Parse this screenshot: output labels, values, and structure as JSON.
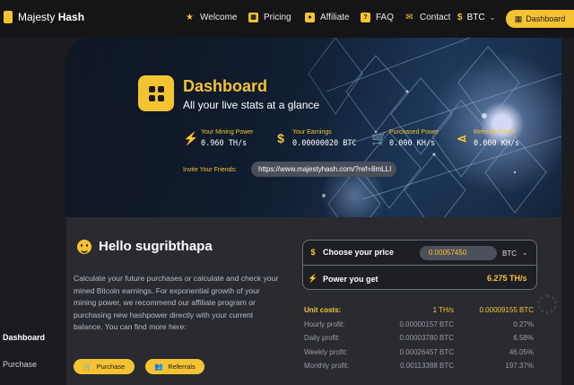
{
  "brand": {
    "first": "Majesty ",
    "second": "Hash"
  },
  "nav": [
    {
      "label": "Welcome",
      "icon": "star-icon"
    },
    {
      "label": "Pricing",
      "icon": "grid-icon"
    },
    {
      "label": "Affiliate",
      "icon": "person-icon"
    },
    {
      "label": "FAQ",
      "icon": "question-icon"
    },
    {
      "label": "Contact",
      "icon": "mail-icon"
    }
  ],
  "currency": {
    "symbol": "$",
    "label": "BTC"
  },
  "dashboard_button": "Dashboard",
  "sidebar": {
    "active": "Dashboard",
    "item": "Purchase"
  },
  "hero": {
    "title": "Dashboard",
    "subtitle": "All your live stats at a glance",
    "stats": [
      {
        "label": "Your Mining Power",
        "value": "0.960 TH/s",
        "icon": "bolt-icon"
      },
      {
        "label": "Your Earnings",
        "value": "0.00000020 BTC",
        "icon": "dollar-icon"
      },
      {
        "label": "Purchased Power",
        "value": "0.000 KH/s",
        "icon": "cart-icon"
      },
      {
        "label": "Referral Power",
        "value": "0.000 KH/s",
        "icon": "share-icon"
      }
    ],
    "invite_label": "Invite Your Friends:",
    "invite_url": "https://www.majestyhash.com/?ref=8mLLI"
  },
  "greeting": "Hello sugribthapa",
  "intro": "Calculate your future purchases or calculate and check your mined Bitcoin earnings. For exponential growth of your mining power, we recommend our affiliate program or purchasing new hashpower directly with your current balance. You can find more here:",
  "buttons": {
    "purchase": "Purchase",
    "referrals": "Referrals"
  },
  "calculator": {
    "price_label": "Choose your price",
    "price_value": "0.00057450",
    "price_unit": "BTC",
    "power_label": "Power you get",
    "power_value": "6.275 TH/s"
  },
  "profit_table": {
    "header": {
      "label": "Unit costs:",
      "unit": "1 TH/s",
      "value": "0.00009155 BTC"
    },
    "rows": [
      {
        "label": "Hourly profit:",
        "btc": "0.00000157 BTC",
        "pct": "0.27%"
      },
      {
        "label": "Daily profit:",
        "btc": "0.00003780 BTC",
        "pct": "6.58%"
      },
      {
        "label": "Weekly profit:",
        "btc": "0.00026457 BTC",
        "pct": "46.05%"
      },
      {
        "label": "Monthly profit:",
        "btc": "0.00113388 BTC",
        "pct": "197.37%"
      }
    ]
  },
  "colors": {
    "accent": "#f5c332",
    "background": "#1c1c20",
    "panel": "#2a2b31"
  }
}
